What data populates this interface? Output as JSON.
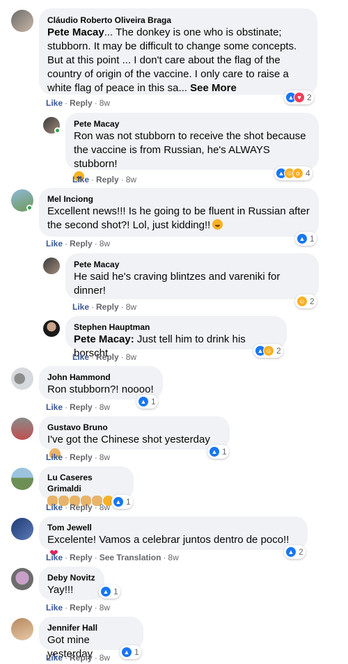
{
  "comments": [
    {
      "author": "Cláudio Roberto Oliveira Braga",
      "mention": "Pete Macay",
      "text": "... The donkey is one who is obstinate; stubborn. It may be difficult to change some concepts. But at this point ... I don't care about the flag of the country of origin of the vaccine. I only care to raise a white flag of peace in this sa...",
      "see_more": "See More",
      "reaction_count": "2",
      "time": "8w"
    },
    {
      "author": "Pete Macay",
      "text": "Ron was not stubborn to receive the shot because the vaccine is from Russian, he's ALWAYS stubborn!",
      "reaction_count": "4",
      "time": "8w"
    },
    {
      "author": "Mel Inciong",
      "text": "Excellent news!!! Is he going to be fluent in Russian after the second shot?! Lol, just kidding!!",
      "reaction_count": "1",
      "time": "8w"
    },
    {
      "author": "Pete Macay",
      "text": "He said he's craving blintzes and vareniki for dinner!",
      "reaction_count": "2",
      "time": "8w"
    },
    {
      "author": "Stephen Hauptman",
      "mention": "Pete Macay:",
      "text": " Just tell him to drink his borscht",
      "reaction_count": "2",
      "time": "8w"
    },
    {
      "author": "John Hammond",
      "text": "Ron stubborn?! noooo!",
      "reaction_count": "1",
      "time": "8w"
    },
    {
      "author": "Gustavo Bruno",
      "text": "I've got the Chinese shot yesterday",
      "reaction_count": "1",
      "time": "8w"
    },
    {
      "author": "Lu Caseres Grimaldi",
      "text": "",
      "reaction_count": "1",
      "time": "8w"
    },
    {
      "author": "Tom Jewell",
      "text": "Excelente! Vamos a celebrar juntos dentro de poco!!",
      "reaction_count": "2",
      "time": "8w",
      "see_translation": "See Translation"
    },
    {
      "author": "Deby Novitz",
      "text": "Yay!!!",
      "reaction_count": "1",
      "time": "8w"
    },
    {
      "author": "Jennifer Hall",
      "text": "Got mine yesterday",
      "reaction_count": "1",
      "time": "8w"
    }
  ],
  "labels": {
    "like": "Like",
    "reply": "Reply",
    "dot": "·"
  },
  "colors": {
    "bubble": "#f0f2f5",
    "like_blue": "#1877f2",
    "love_red": "#f33e58",
    "haha_yellow": "#f7b125",
    "link_blue": "#385898",
    "meta_gray": "#65676b"
  },
  "icons": [
    "like-reaction-icon",
    "love-reaction-icon",
    "haha-reaction-icon",
    "online-status-icon"
  ]
}
